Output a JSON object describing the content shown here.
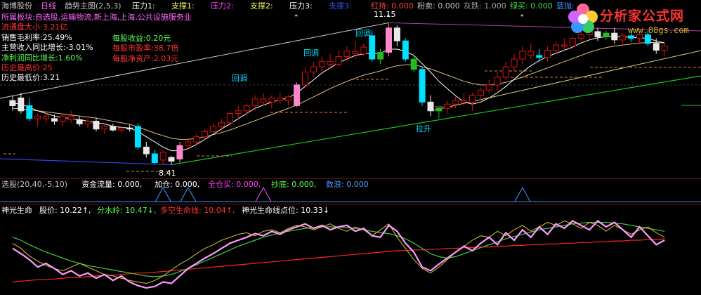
{
  "header": {
    "items": [
      {
        "text": "海博股份",
        "color": "#c0c0c0"
      },
      {
        "text": "日线",
        "color": "#ff66ff"
      },
      {
        "text": "趋势主图(2,5,3)",
        "color": "#c0c0c0"
      },
      {
        "text": "压力1:",
        "color": "#ffffff"
      },
      {
        "text": "支撑1:",
        "color": "#ffff55"
      },
      {
        "text": "压力2:",
        "color": "#ff44ff"
      },
      {
        "text": "支撑2:",
        "color": "#ffff55"
      },
      {
        "text": "压力3:",
        "color": "#ffffff"
      },
      {
        "text": "支撑3:",
        "color": "#3355ff"
      },
      {
        "text": "红持: 0.000",
        "color": "#ff4444"
      },
      {
        "text": "粉卖: 0.000",
        "color": "#c0c0c0"
      },
      {
        "text": "灰跌: 1.000",
        "color": "#a0a0a0"
      },
      {
        "text": "绿买: 0.000",
        "color": "#44dd44"
      },
      {
        "text": "蓝抛:",
        "color": "#4488ff"
      }
    ]
  },
  "info": [
    {
      "text": "所属板块:自选股,运输物流,新上海,上海,公共设施服务业",
      "color": "#ff66ff"
    },
    {
      "text": "流通盘大小:3.21亿",
      "color": "#ff3333"
    },
    {
      "text": "销售毛利率:25.49%",
      "color": "#ffffff"
    },
    {
      "text": "主营收入同比增长:-3.01%",
      "color": "#ffffff"
    },
    {
      "text": "净利润同比增长:1.60%",
      "color": "#55ff55"
    },
    {
      "text": "历史最高价:25",
      "color": "#ff3333"
    },
    {
      "text": "历史最低价:3.21",
      "color": "#ffffff"
    }
  ],
  "info_right": [
    {
      "text": "每股收益:0.20元",
      "color": "#55ff55"
    },
    {
      "text": "每股市盈率:38.7倍",
      "color": "#ff3333"
    },
    {
      "text": "每股净资产:2.03元",
      "color": "#ff3333"
    }
  ],
  "annotations": {
    "huitiao": "回调",
    "lasheng": "拉升",
    "low_price": "8.41",
    "high_price": "11.15"
  },
  "indicator1": {
    "items": [
      {
        "text": "选股(20,40,-5,10)",
        "color": "#c0c0c0"
      },
      {
        "text": "资金流量: 0.000,",
        "color": "#ffffff"
      },
      {
        "text": "加仓: 0.000,",
        "color": "#ffffff"
      },
      {
        "text": "全仓买: 0.000,",
        "color": "#ff44ff"
      },
      {
        "text": "抄底: 0.000,",
        "color": "#55ff55"
      },
      {
        "text": "数浪: 0.000",
        "color": "#4499ff"
      }
    ]
  },
  "indicator2": {
    "items": [
      {
        "text": "神光生命",
        "color": "#ffffff"
      },
      {
        "text": "股价: 10.22↑,",
        "color": "#ffffff"
      },
      {
        "text": "分水岭: 10.47↓,",
        "color": "#55ff55"
      },
      {
        "text": "多空生命线: 10.04↑,",
        "color": "#ff3333"
      },
      {
        "text": "神光生命线点位: 10.33↓",
        "color": "#ffffff"
      }
    ]
  },
  "logo": {
    "title": "分析家公式网",
    "url": "www.88gs.com"
  },
  "colors": {
    "bg": "#000000",
    "up": "#e01010",
    "down": "#00c8c8",
    "pink": "#ff88cc",
    "cyan": "#00e0ff",
    "white": "#e8e8e8",
    "green": "#22bb22",
    "ma1": "#ffffff",
    "ma2": "#e0c080",
    "trend": "#20c020",
    "support": "#ffffff",
    "blue_line": "#3344dd",
    "orange_dash": "#e08040",
    "grid": "#3a3a3a",
    "osc_price": "#ff99ff",
    "osc_red": "#ff2222",
    "osc_green": "#44cc44",
    "osc_yellow": "#d8c030",
    "osc_white": "#ffffff"
  },
  "chart_data": {
    "type": "candlestick",
    "ylim": [
      8.2,
      11.4
    ],
    "candles": [
      {
        "o": 9.55,
        "h": 9.75,
        "l": 9.45,
        "c": 9.65,
        "k": "w"
      },
      {
        "o": 9.7,
        "h": 9.8,
        "l": 9.4,
        "c": 9.45,
        "k": "w"
      },
      {
        "o": 9.55,
        "h": 9.7,
        "l": 9.25,
        "c": 9.3,
        "k": "c"
      },
      {
        "o": 9.3,
        "h": 9.4,
        "l": 9.15,
        "c": 9.35,
        "k": "u"
      },
      {
        "o": 9.35,
        "h": 9.45,
        "l": 9.2,
        "c": 9.3,
        "k": "u"
      },
      {
        "o": 9.3,
        "h": 9.38,
        "l": 9.18,
        "c": 9.25,
        "k": "w"
      },
      {
        "o": 9.25,
        "h": 9.4,
        "l": 9.15,
        "c": 9.35,
        "k": "u"
      },
      {
        "o": 9.35,
        "h": 9.45,
        "l": 9.22,
        "c": 9.28,
        "k": "u"
      },
      {
        "o": 9.28,
        "h": 9.35,
        "l": 9.15,
        "c": 9.2,
        "k": "w"
      },
      {
        "o": 9.2,
        "h": 9.3,
        "l": 9.12,
        "c": 9.25,
        "k": "u"
      },
      {
        "o": 9.25,
        "h": 9.32,
        "l": 9.05,
        "c": 9.1,
        "k": "w"
      },
      {
        "o": 9.1,
        "h": 9.2,
        "l": 9.0,
        "c": 9.15,
        "k": "u"
      },
      {
        "o": 9.15,
        "h": 9.2,
        "l": 9.05,
        "c": 9.08,
        "k": "w"
      },
      {
        "o": 9.08,
        "h": 9.15,
        "l": 9.02,
        "c": 9.12,
        "k": "u"
      },
      {
        "o": 9.12,
        "h": 9.18,
        "l": 9.05,
        "c": 9.1,
        "k": "w"
      },
      {
        "o": 9.15,
        "h": 9.2,
        "l": 8.7,
        "c": 8.75,
        "k": "c"
      },
      {
        "o": 8.75,
        "h": 8.85,
        "l": 8.55,
        "c": 8.62,
        "k": "w"
      },
      {
        "o": 8.62,
        "h": 8.7,
        "l": 8.42,
        "c": 8.45,
        "k": "c"
      },
      {
        "o": 8.5,
        "h": 8.7,
        "l": 8.41,
        "c": 8.65,
        "k": "u"
      },
      {
        "o": 8.48,
        "h": 8.58,
        "l": 8.42,
        "c": 8.55,
        "k": "w"
      },
      {
        "o": 8.52,
        "h": 8.85,
        "l": 8.45,
        "c": 8.78,
        "k": "p"
      },
      {
        "o": 8.78,
        "h": 8.9,
        "l": 8.7,
        "c": 8.85,
        "k": "u"
      },
      {
        "o": 8.85,
        "h": 9.0,
        "l": 8.8,
        "c": 8.95,
        "k": "u"
      },
      {
        "o": 8.95,
        "h": 9.1,
        "l": 8.9,
        "c": 9.05,
        "k": "u"
      },
      {
        "o": 9.05,
        "h": 9.2,
        "l": 9.0,
        "c": 9.15,
        "k": "u"
      },
      {
        "o": 9.15,
        "h": 9.3,
        "l": 9.05,
        "c": 9.22,
        "k": "u"
      },
      {
        "o": 9.22,
        "h": 9.45,
        "l": 9.15,
        "c": 9.4,
        "k": "u"
      },
      {
        "o": 9.4,
        "h": 9.55,
        "l": 9.3,
        "c": 9.45,
        "k": "u"
      },
      {
        "o": 9.45,
        "h": 9.6,
        "l": 9.35,
        "c": 9.55,
        "k": "u"
      },
      {
        "o": 9.55,
        "h": 9.75,
        "l": 9.45,
        "c": 9.68,
        "k": "u"
      },
      {
        "o": 9.68,
        "h": 9.8,
        "l": 9.55,
        "c": 9.62,
        "k": "u"
      },
      {
        "o": 9.62,
        "h": 9.75,
        "l": 9.5,
        "c": 9.7,
        "k": "u"
      },
      {
        "o": 9.7,
        "h": 9.8,
        "l": 9.58,
        "c": 9.65,
        "k": "u"
      },
      {
        "o": 9.65,
        "h": 9.75,
        "l": 9.55,
        "c": 9.72,
        "k": "u"
      },
      {
        "o": 9.55,
        "h": 10.0,
        "l": 9.52,
        "c": 9.95,
        "k": "p"
      },
      {
        "o": 9.95,
        "h": 10.3,
        "l": 9.9,
        "c": 10.2,
        "k": "u"
      },
      {
        "o": 10.2,
        "h": 10.4,
        "l": 10.1,
        "c": 10.3,
        "k": "u"
      },
      {
        "o": 10.3,
        "h": 10.5,
        "l": 10.2,
        "c": 10.4,
        "k": "u"
      },
      {
        "o": 10.4,
        "h": 10.55,
        "l": 10.28,
        "c": 10.35,
        "k": "u"
      },
      {
        "o": 10.35,
        "h": 10.6,
        "l": 10.3,
        "c": 10.5,
        "k": "u"
      },
      {
        "o": 10.5,
        "h": 10.7,
        "l": 10.4,
        "c": 10.6,
        "k": "u"
      },
      {
        "o": 10.6,
        "h": 10.8,
        "l": 10.45,
        "c": 10.55,
        "k": "u"
      },
      {
        "o": 10.55,
        "h": 10.75,
        "l": 10.5,
        "c": 10.68,
        "k": "u"
      },
      {
        "o": 10.9,
        "h": 11.0,
        "l": 10.4,
        "c": 10.45,
        "k": "c"
      },
      {
        "o": 10.45,
        "h": 10.65,
        "l": 10.35,
        "c": 10.58,
        "k": "g"
      },
      {
        "o": 10.58,
        "h": 11.15,
        "l": 10.5,
        "c": 11.05,
        "k": "p"
      },
      {
        "o": 11.05,
        "h": 11.1,
        "l": 10.7,
        "c": 10.8,
        "k": "w"
      },
      {
        "o": 10.8,
        "h": 10.85,
        "l": 10.4,
        "c": 10.45,
        "k": "c"
      },
      {
        "o": 10.45,
        "h": 10.55,
        "l": 10.2,
        "c": 10.25,
        "k": "g"
      },
      {
        "o": 10.25,
        "h": 10.3,
        "l": 9.55,
        "c": 9.62,
        "k": "c"
      },
      {
        "o": 9.62,
        "h": 9.75,
        "l": 9.35,
        "c": 9.45,
        "k": "w"
      },
      {
        "o": 9.45,
        "h": 9.55,
        "l": 9.3,
        "c": 9.5,
        "k": "g"
      },
      {
        "o": 9.5,
        "h": 9.65,
        "l": 9.4,
        "c": 9.58,
        "k": "u"
      },
      {
        "o": 9.58,
        "h": 9.72,
        "l": 9.5,
        "c": 9.65,
        "k": "u"
      },
      {
        "o": 9.65,
        "h": 9.8,
        "l": 9.55,
        "c": 9.62,
        "k": "u"
      },
      {
        "o": 9.62,
        "h": 9.8,
        "l": 9.45,
        "c": 9.75,
        "k": "u"
      },
      {
        "o": 9.75,
        "h": 9.9,
        "l": 9.65,
        "c": 9.85,
        "k": "u"
      },
      {
        "o": 9.85,
        "h": 10.05,
        "l": 9.78,
        "c": 9.95,
        "k": "u"
      },
      {
        "o": 9.95,
        "h": 10.2,
        "l": 9.85,
        "c": 10.1,
        "k": "u"
      },
      {
        "o": 10.1,
        "h": 10.4,
        "l": 10.05,
        "c": 10.3,
        "k": "u"
      },
      {
        "o": 10.3,
        "h": 10.55,
        "l": 10.2,
        "c": 10.45,
        "k": "u"
      },
      {
        "o": 10.45,
        "h": 10.7,
        "l": 10.35,
        "c": 10.6,
        "k": "u"
      },
      {
        "o": 10.6,
        "h": 10.75,
        "l": 10.45,
        "c": 10.52,
        "k": "u"
      },
      {
        "o": 10.52,
        "h": 10.65,
        "l": 10.4,
        "c": 10.48,
        "k": "c"
      },
      {
        "o": 10.48,
        "h": 10.7,
        "l": 10.4,
        "c": 10.62,
        "k": "u"
      },
      {
        "o": 10.62,
        "h": 10.8,
        "l": 10.55,
        "c": 10.72,
        "k": "u"
      },
      {
        "o": 10.72,
        "h": 10.85,
        "l": 10.6,
        "c": 10.7,
        "k": "u"
      },
      {
        "o": 10.7,
        "h": 10.9,
        "l": 10.65,
        "c": 10.85,
        "k": "u"
      },
      {
        "o": 10.85,
        "h": 11.0,
        "l": 10.78,
        "c": 10.92,
        "k": "u"
      },
      {
        "o": 10.92,
        "h": 11.05,
        "l": 10.85,
        "c": 10.98,
        "k": "u"
      },
      {
        "o": 10.98,
        "h": 11.05,
        "l": 10.8,
        "c": 10.88,
        "k": "w"
      },
      {
        "o": 10.88,
        "h": 11.0,
        "l": 10.82,
        "c": 10.95,
        "k": "g"
      },
      {
        "o": 10.95,
        "h": 11.05,
        "l": 10.75,
        "c": 10.82,
        "k": "w"
      },
      {
        "o": 10.82,
        "h": 10.95,
        "l": 10.7,
        "c": 10.9,
        "k": "u"
      },
      {
        "o": 10.9,
        "h": 11.0,
        "l": 10.78,
        "c": 10.85,
        "k": "c"
      },
      {
        "o": 10.85,
        "h": 10.98,
        "l": 10.75,
        "c": 10.92,
        "k": "u"
      },
      {
        "o": 10.92,
        "h": 11.0,
        "l": 10.7,
        "c": 10.75,
        "k": "c"
      },
      {
        "o": 10.75,
        "h": 10.85,
        "l": 10.55,
        "c": 10.62,
        "k": "w"
      },
      {
        "o": 10.62,
        "h": 10.75,
        "l": 10.5,
        "c": 10.7,
        "k": "u"
      }
    ],
    "ma_short": [
      9.6,
      9.58,
      9.52,
      9.45,
      9.4,
      9.35,
      9.32,
      9.3,
      9.28,
      9.25,
      9.22,
      9.2,
      9.15,
      9.13,
      9.12,
      9.05,
      8.95,
      8.85,
      8.75,
      8.68,
      8.68,
      8.72,
      8.8,
      8.9,
      9.0,
      9.1,
      9.2,
      9.3,
      9.4,
      9.5,
      9.56,
      9.62,
      9.66,
      9.7,
      9.8,
      9.92,
      10.05,
      10.18,
      10.28,
      10.38,
      10.45,
      10.52,
      10.55,
      10.56,
      10.56,
      10.64,
      10.64,
      10.6,
      10.52,
      10.36,
      10.2,
      10.02,
      9.88,
      9.74,
      9.62,
      9.58,
      9.62,
      9.7,
      9.8,
      9.92,
      10.06,
      10.2,
      10.32,
      10.42,
      10.5,
      10.56,
      10.62,
      10.68,
      10.76,
      10.82,
      10.86,
      10.88,
      10.88,
      10.88,
      10.87,
      10.86,
      10.85,
      10.8,
      10.76
    ],
    "ma_long": [
      9.5,
      9.49,
      9.47,
      9.45,
      9.43,
      9.41,
      9.39,
      9.37,
      9.35,
      9.33,
      9.31,
      9.28,
      9.25,
      9.22,
      9.19,
      9.14,
      9.08,
      9.02,
      8.97,
      8.92,
      8.9,
      8.9,
      8.92,
      8.95,
      8.99,
      9.03,
      9.08,
      9.14,
      9.2,
      9.26,
      9.32,
      9.38,
      9.44,
      9.5,
      9.56,
      9.64,
      9.72,
      9.8,
      9.88,
      9.95,
      10.02,
      10.08,
      10.14,
      10.18,
      10.22,
      10.28,
      10.32,
      10.34,
      10.34,
      10.3,
      10.26,
      10.2,
      10.14,
      10.08,
      10.02,
      9.98,
      9.95,
      9.95,
      9.97,
      10.0,
      10.05,
      10.1,
      10.16,
      10.22,
      10.28,
      10.34,
      10.4,
      10.46,
      10.52,
      10.58,
      10.63,
      10.67,
      10.7,
      10.72,
      10.74,
      10.76,
      10.77,
      10.77,
      10.76
    ],
    "signals1": [
      {
        "i": 18,
        "color": "#4499ff"
      },
      {
        "i": 21,
        "color": "#4499ff"
      },
      {
        "i": 30,
        "color": "#ff44ff"
      },
      {
        "i": 61,
        "color": "#4499ff"
      }
    ],
    "osc_price": [
      0.55,
      0.48,
      0.4,
      0.3,
      0.35,
      0.28,
      0.2,
      0.25,
      0.18,
      0.22,
      0.15,
      0.2,
      0.12,
      0.18,
      0.1,
      0.05,
      0.02,
      0.04,
      0.1,
      0.08,
      0.18,
      0.28,
      0.35,
      0.42,
      0.48,
      0.55,
      0.62,
      0.66,
      0.7,
      0.75,
      0.72,
      0.78,
      0.74,
      0.8,
      0.84,
      0.88,
      0.82,
      0.86,
      0.8,
      0.84,
      0.86,
      0.78,
      0.82,
      0.72,
      0.7,
      0.86,
      0.78,
      0.62,
      0.5,
      0.3,
      0.25,
      0.34,
      0.42,
      0.5,
      0.58,
      0.52,
      0.62,
      0.7,
      0.6,
      0.76,
      0.66,
      0.8,
      0.7,
      0.84,
      0.74,
      0.88,
      0.82,
      0.92,
      0.86,
      0.8,
      0.92,
      0.84,
      0.9,
      0.8,
      0.7,
      0.84,
      0.72,
      0.6,
      0.66
    ],
    "osc_red": [
      0.1,
      0.11,
      0.12,
      0.13,
      0.13,
      0.14,
      0.15,
      0.16,
      0.16,
      0.17,
      0.18,
      0.19,
      0.19,
      0.2,
      0.21,
      0.22,
      0.22,
      0.23,
      0.24,
      0.25,
      0.26,
      0.27,
      0.28,
      0.29,
      0.3,
      0.31,
      0.32,
      0.33,
      0.34,
      0.35,
      0.36,
      0.37,
      0.38,
      0.39,
      0.4,
      0.41,
      0.42,
      0.43,
      0.44,
      0.45,
      0.46,
      0.47,
      0.48,
      0.49,
      0.5,
      0.51,
      0.52,
      0.52,
      0.53,
      0.53,
      0.54,
      0.54,
      0.55,
      0.55,
      0.56,
      0.56,
      0.57,
      0.57,
      0.58,
      0.58,
      0.59,
      0.59,
      0.6,
      0.6,
      0.61,
      0.61,
      0.62,
      0.62,
      0.63,
      0.63,
      0.64,
      0.64,
      0.65,
      0.65,
      0.66,
      0.66,
      0.67,
      0.67,
      0.68
    ],
    "osc_green": [
      0.7,
      0.66,
      0.6,
      0.55,
      0.5,
      0.46,
      0.42,
      0.38,
      0.35,
      0.32,
      0.3,
      0.28,
      0.26,
      0.24,
      0.22,
      0.2,
      0.18,
      0.17,
      0.18,
      0.2,
      0.24,
      0.28,
      0.33,
      0.38,
      0.43,
      0.48,
      0.53,
      0.58,
      0.62,
      0.66,
      0.7,
      0.73,
      0.76,
      0.78,
      0.8,
      0.82,
      0.83,
      0.84,
      0.84,
      0.84,
      0.83,
      0.82,
      0.8,
      0.78,
      0.76,
      0.75,
      0.72,
      0.68,
      0.62,
      0.55,
      0.48,
      0.44,
      0.42,
      0.44,
      0.48,
      0.52,
      0.56,
      0.6,
      0.64,
      0.68,
      0.71,
      0.74,
      0.77,
      0.8,
      0.82,
      0.84,
      0.86,
      0.88,
      0.89,
      0.9,
      0.9,
      0.9,
      0.89,
      0.88,
      0.86,
      0.84,
      0.82,
      0.8,
      0.78
    ],
    "osc_yellow": [
      0.62,
      0.55,
      0.45,
      0.38,
      0.32,
      0.28,
      0.25,
      0.3,
      0.35,
      0.3,
      0.25,
      0.2,
      0.18,
      0.15,
      0.12,
      0.1,
      0.08,
      0.12,
      0.18,
      0.26,
      0.34,
      0.4,
      0.48,
      0.55,
      0.6,
      0.66,
      0.7,
      0.74,
      0.76,
      0.72,
      0.78,
      0.8,
      0.76,
      0.82,
      0.86,
      0.84,
      0.8,
      0.84,
      0.88,
      0.82,
      0.78,
      0.84,
      0.8,
      0.72,
      0.8,
      0.88,
      0.7,
      0.55,
      0.4,
      0.28,
      0.22,
      0.3,
      0.4,
      0.5,
      0.58,
      0.66,
      0.72,
      0.7,
      0.78,
      0.72,
      0.8,
      0.86,
      0.78,
      0.84,
      0.9,
      0.86,
      0.92,
      0.88,
      0.82,
      0.9,
      0.86,
      0.78,
      0.86,
      0.8,
      0.74,
      0.8,
      0.84,
      0.76,
      0.7
    ]
  }
}
